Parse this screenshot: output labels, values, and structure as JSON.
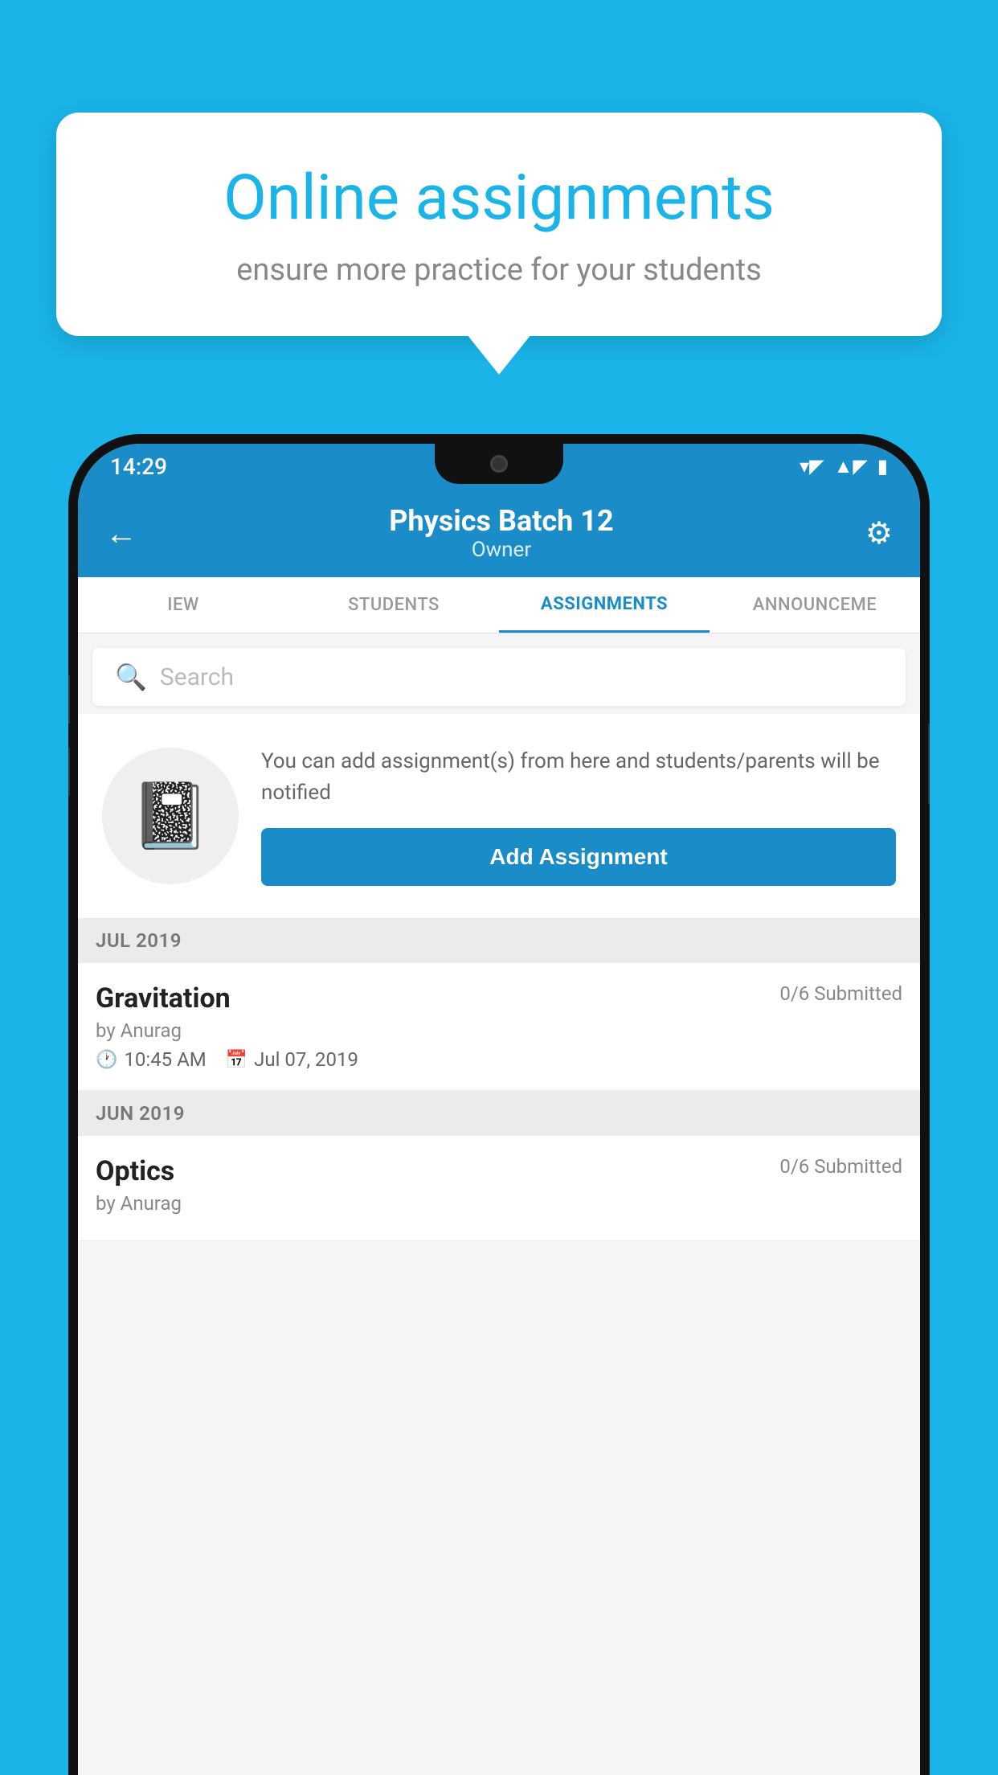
{
  "background_color": "#1ab4e8",
  "bubble": {
    "title": "Online assignments",
    "subtitle": "ensure more practice for your students"
  },
  "status_bar": {
    "time": "14:29",
    "wifi_icon": "▼",
    "signal_icon": "◀",
    "battery_icon": "▮"
  },
  "header": {
    "back_label": "←",
    "title": "Physics Batch 12",
    "subtitle": "Owner",
    "settings_icon": "⚙"
  },
  "tabs": [
    {
      "label": "IEW",
      "active": false
    },
    {
      "label": "STUDENTS",
      "active": false
    },
    {
      "label": "ASSIGNMENTS",
      "active": true
    },
    {
      "label": "ANNOUNCEME",
      "active": false
    }
  ],
  "search": {
    "placeholder": "Search"
  },
  "empty_state": {
    "description": "You can add assignment(s) from here and students/parents will be notified",
    "add_button_label": "Add Assignment"
  },
  "sections": [
    {
      "month": "JUL 2019",
      "assignments": [
        {
          "title": "Gravitation",
          "submitted": "0/6 Submitted",
          "by": "by Anurag",
          "time": "10:45 AM",
          "date": "Jul 07, 2019"
        }
      ]
    },
    {
      "month": "JUN 2019",
      "assignments": [
        {
          "title": "Optics",
          "submitted": "0/6 Submitted",
          "by": "by Anurag",
          "time": "",
          "date": ""
        }
      ]
    }
  ]
}
